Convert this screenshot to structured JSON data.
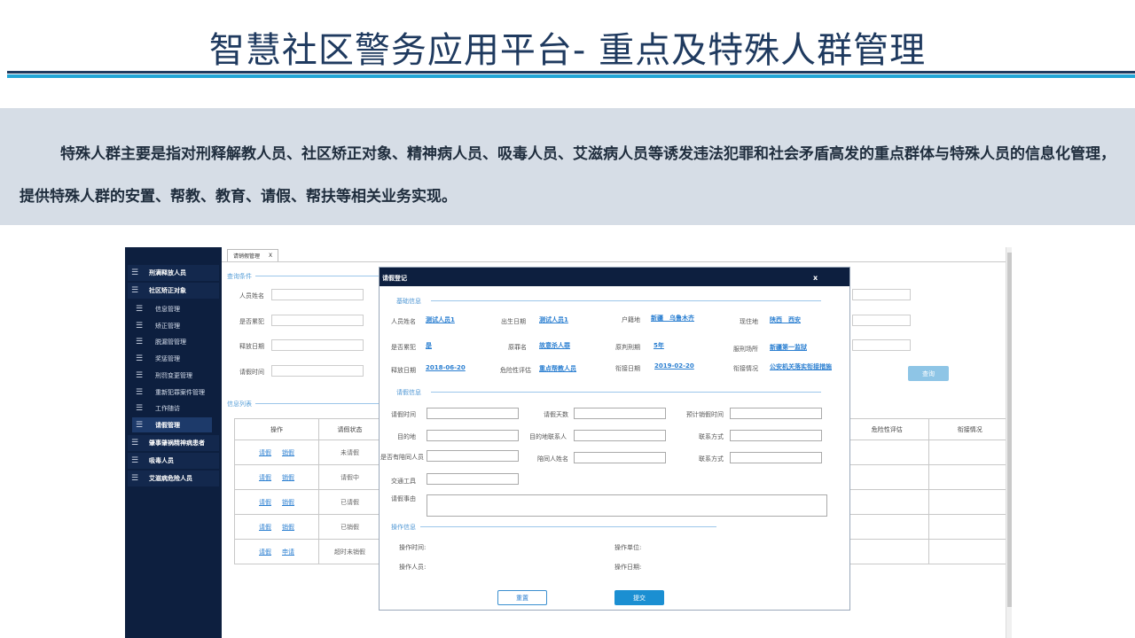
{
  "slide": {
    "title": "智慧社区警务应用平台- 重点及特殊人群管理",
    "description": "特殊人群主要是指对刑释解教人员、社区矫正对象、精神病人员、吸毒人员、艾滋病人员等诱发违法犯罪和社会矛盾高发的重点群体与特殊人员的信息化管理，提供特殊人群的安置、帮教、教育、请假、帮扶等相关业务实现。"
  },
  "sidebar": {
    "items": [
      {
        "label": "刑满释放人员",
        "icon": "list-icon"
      },
      {
        "label": "社区矫正对象",
        "icon": "list-icon"
      },
      {
        "label": "信息管理",
        "icon": "list-icon"
      },
      {
        "label": "矫正管理",
        "icon": "list-icon"
      },
      {
        "label": "脱漏管管理",
        "icon": "list-icon"
      },
      {
        "label": "奖惩管理",
        "icon": "list-icon"
      },
      {
        "label": "刑罚变更管理",
        "icon": "list-icon"
      },
      {
        "label": "重新犯罪案件管理",
        "icon": "list-icon"
      },
      {
        "label": "工作随访",
        "icon": "list-icon"
      },
      {
        "label": "请假管理",
        "icon": "list-icon"
      },
      {
        "label": "肇事肇祸精神病患者",
        "icon": "list-icon"
      },
      {
        "label": "吸毒人员",
        "icon": "list-icon"
      },
      {
        "label": "艾滋病危险人员",
        "icon": "list-icon"
      }
    ]
  },
  "tab": {
    "label": "请销假管理",
    "close": "X"
  },
  "query": {
    "section": "查询条件",
    "fields": [
      "人员姓名",
      "是否累犯",
      "释放日期",
      "请假时间"
    ],
    "button": "查询"
  },
  "list": {
    "section": "信息列表",
    "headers": [
      "操作",
      "请假状态"
    ],
    "rows": [
      {
        "op1": "请假",
        "op2": "销假",
        "status": "未请假"
      },
      {
        "op1": "请假",
        "op2": "销假",
        "status": "请假中"
      },
      {
        "op1": "请假",
        "op2": "销假",
        "status": "已请假"
      },
      {
        "op1": "请假",
        "op2": "销假",
        "status": "已销假"
      },
      {
        "op1": "请假",
        "op2": "申请",
        "status": "超时未销假"
      }
    ],
    "right_headers": [
      "危险性评估",
      "衔接情况"
    ]
  },
  "modal": {
    "title": "请假登记",
    "close": "x",
    "basic_section": "基础信息",
    "basic": {
      "name_label": "人员姓名",
      "name_value": "测试人员1",
      "birth_label": "出生日期",
      "birth_value": "测试人员1",
      "huji_label": "户籍地",
      "huji_value": "新疆　乌鲁木齐",
      "current_label": "现住地",
      "current_value": "陕西　西安",
      "recid_label": "是否累犯",
      "recid_value": "是",
      "crime_label": "原罪名",
      "crime_value": "故意杀人罪",
      "term_label": "原判刑期",
      "term_value": "5年",
      "prison_label": "服刑场所",
      "prison_value": "新疆第一监狱",
      "release_label": "释放日期",
      "release_value": "2018-06-20",
      "risk_label": "危险性评估",
      "risk_value": "重点帮教人员",
      "link_date_label": "衔接日期",
      "link_date_value": "2019-02-20",
      "link_status_label": "衔接情况",
      "link_status_value": "公安机关落实衔接措施"
    },
    "leave_section": "请假信息",
    "leave": {
      "time": "请假时间",
      "days": "请假天数",
      "expected": "预计销假时间",
      "dest": "目的地",
      "contact_person": "目的地联系人",
      "phone": "联系方式",
      "companion": "是否有陪同人员",
      "companion_name": "陪同人姓名",
      "phone2": "联系方式",
      "transport": "交通工具",
      "reason": "请假事由"
    },
    "op_section": "操作信息",
    "op": {
      "time": "操作时间:",
      "unit": "操作单位:",
      "person": "操作人员:",
      "date": "操作日期:"
    },
    "reset": "重置",
    "submit": "提交"
  }
}
